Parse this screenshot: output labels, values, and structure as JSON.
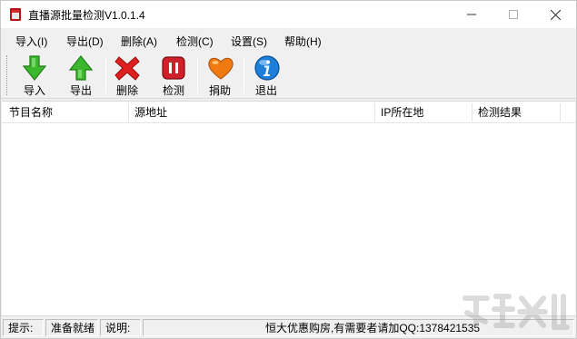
{
  "window": {
    "title": "直播源批量检测V1.0.1.4",
    "controls": {
      "minimize": "—",
      "maximize": "☐",
      "close": "✕"
    }
  },
  "menu": [
    {
      "label": "导入(I)"
    },
    {
      "label": "导出(D)"
    },
    {
      "label": "删除(A)"
    },
    {
      "label": "检测(C)"
    },
    {
      "label": "设置(S)"
    },
    {
      "label": "帮助(H)"
    }
  ],
  "toolbar": [
    {
      "label": "导入",
      "icon": "import-arrow-down-icon",
      "color": "#3cb82e"
    },
    {
      "label": "导出",
      "icon": "export-arrow-up-icon",
      "color": "#3cb82e"
    },
    {
      "label": "删除",
      "icon": "delete-x-icon",
      "color": "#e02020"
    },
    {
      "label": "检测",
      "icon": "pause-icon",
      "color": "#d0202a"
    },
    {
      "label": "捐助",
      "icon": "heart-icon",
      "color": "#f07a10"
    },
    {
      "label": "退出",
      "icon": "info-icon",
      "color": "#1e7ed8"
    }
  ],
  "list": {
    "columns": [
      "节目名称",
      "源地址",
      "IP所在地",
      "检测结果"
    ],
    "rows": []
  },
  "statusbar": {
    "hint_label": "提示:",
    "hint_value": "准备就绪",
    "desc_label": "说明:",
    "desc_value": "恒大优惠购房,有需要者请加QQ:1378421535"
  }
}
